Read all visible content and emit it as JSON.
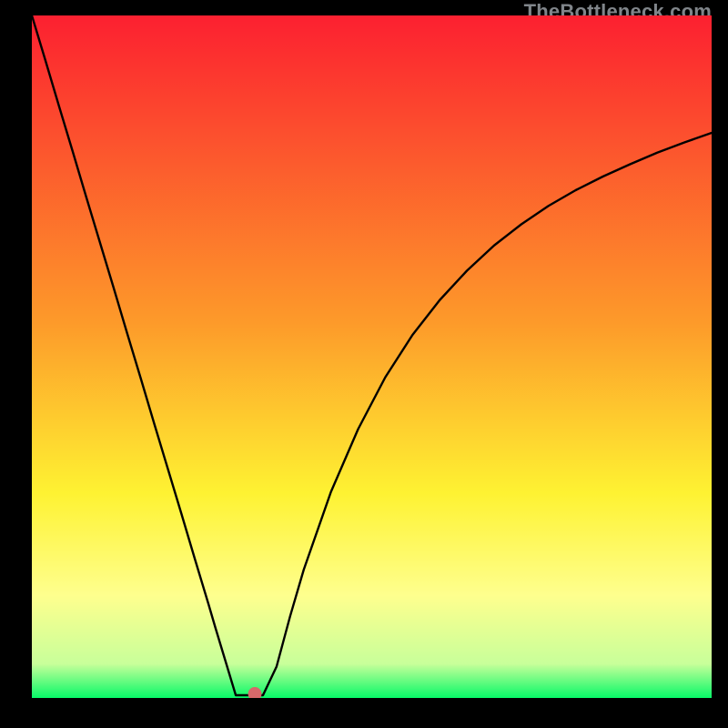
{
  "watermark": "TheBottleneck.com",
  "colors": {
    "gradient_top": "#fc2030",
    "gradient_mid1": "#fd9a2a",
    "gradient_mid2": "#fef232",
    "gradient_mid3": "#feff8e",
    "gradient_bottom": "#07f968",
    "line": "#000000",
    "marker": "#d7686a",
    "frame": "#000000"
  },
  "chart_data": {
    "type": "line",
    "title": "",
    "xlabel": "",
    "ylabel": "",
    "xlim": [
      0,
      100
    ],
    "ylim": [
      0,
      100
    ],
    "x": [
      0,
      2,
      4,
      6,
      8,
      10,
      12,
      14,
      16,
      18,
      20,
      22,
      24,
      26,
      27,
      28,
      29,
      30,
      31,
      32,
      33,
      34,
      36,
      38,
      40,
      44,
      48,
      52,
      56,
      60,
      64,
      68,
      72,
      76,
      80,
      84,
      88,
      92,
      96,
      100
    ],
    "values": [
      100,
      93.4,
      86.7,
      80.1,
      73.4,
      66.8,
      60.2,
      53.5,
      46.9,
      40.2,
      33.6,
      27.0,
      20.3,
      13.7,
      10.3,
      7.0,
      3.7,
      0.4,
      0.4,
      0.4,
      0.4,
      0.4,
      4.6,
      12.0,
      18.8,
      30.2,
      39.4,
      47.0,
      53.2,
      58.3,
      62.6,
      66.3,
      69.4,
      72.1,
      74.4,
      76.4,
      78.2,
      79.9,
      81.4,
      82.8
    ],
    "marker": {
      "x": 32.8,
      "y": 0.6
    }
  }
}
